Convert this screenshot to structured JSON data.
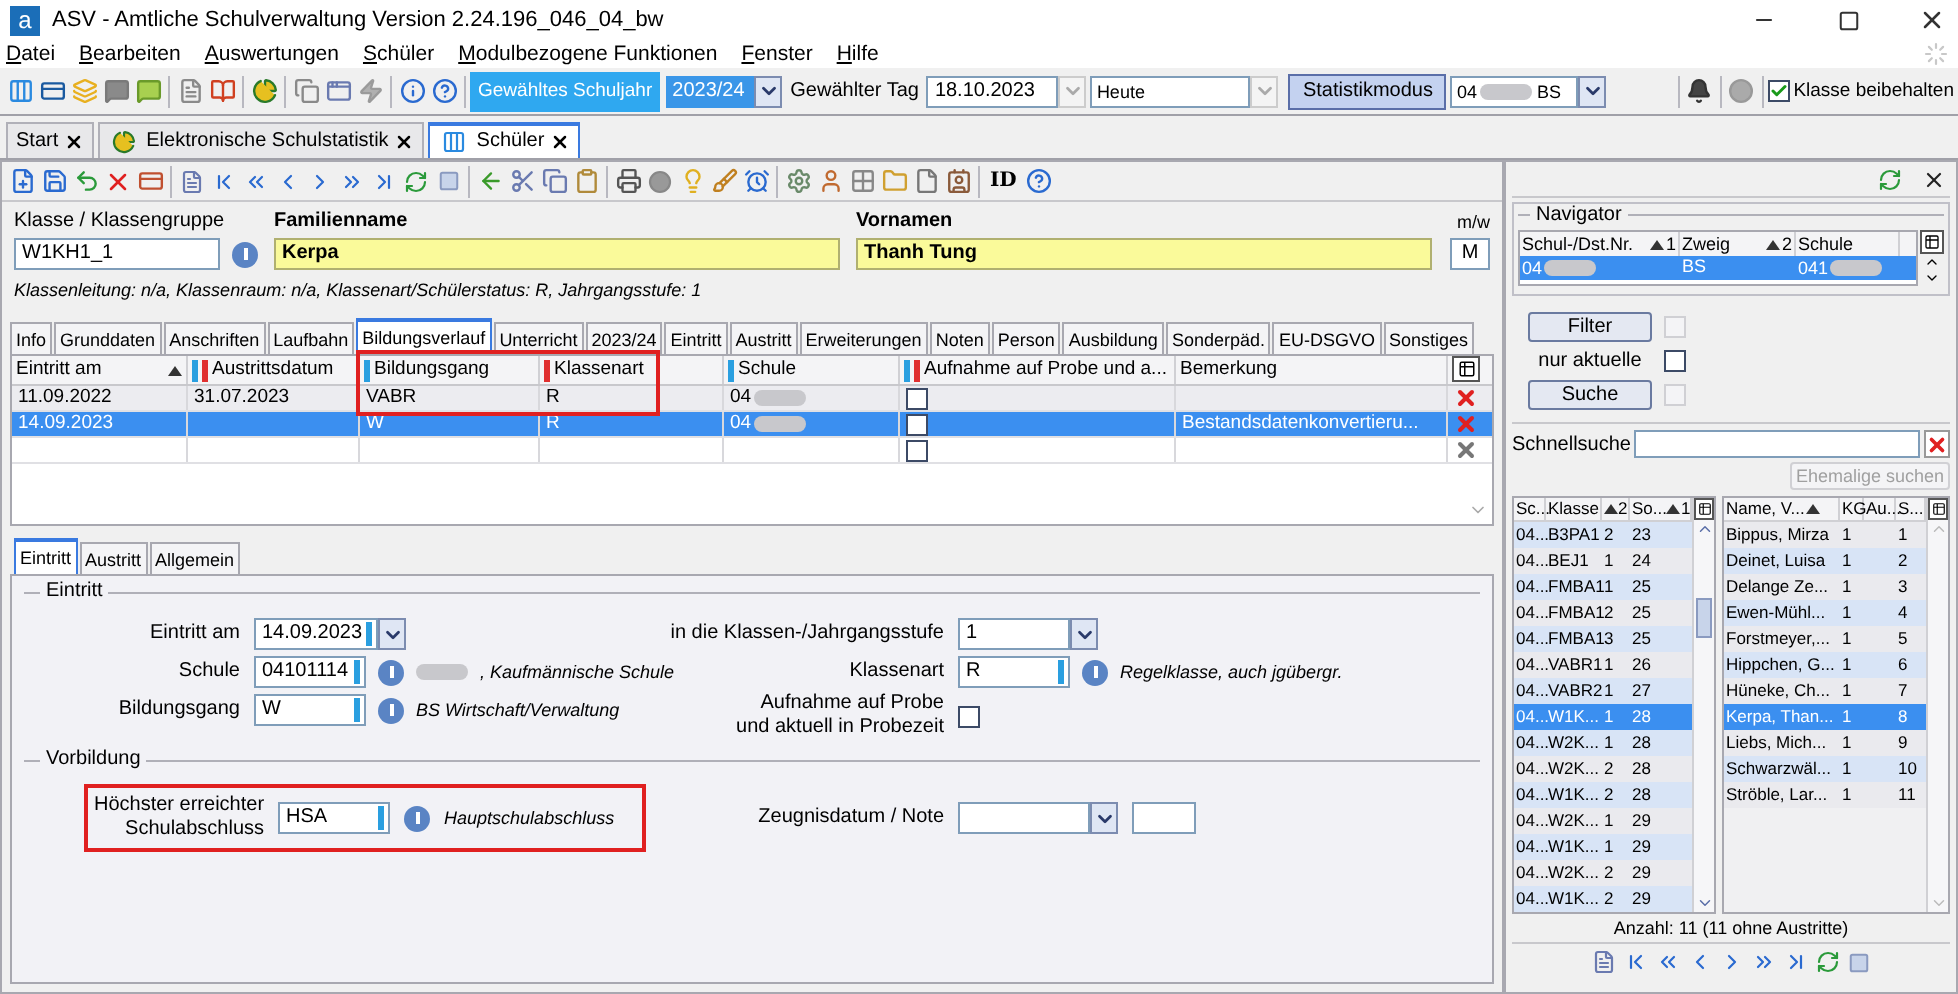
{
  "window": {
    "logo": "a",
    "title": "ASV - Amtliche Schulverwaltung Version 2.24.196_046_04_bw"
  },
  "menu": [
    "Datei",
    "Bearbeiten",
    "Auswertungen",
    "Schüler",
    "Modulbezogene Funktionen",
    "Fenster",
    "Hilfe"
  ],
  "toolbar": {
    "year_button": "Gewähltes Schuljahr",
    "year": "2023/24",
    "day_label": "Gewählter Tag",
    "day": "18.10.2023",
    "day_mode": "Heute",
    "stats_button": "Statistikmodus",
    "school": "04",
    "school_branch": "BS",
    "keep_class": {
      "label": "Klasse beibehalten",
      "checked": true
    }
  },
  "doc_tabs": [
    {
      "label": "Start",
      "selected": false,
      "kind": "plain"
    },
    {
      "label": "Elektronische Schulstatistik",
      "selected": false,
      "kind": "statistics"
    },
    {
      "label": "Schüler",
      "selected": true,
      "kind": "students"
    }
  ],
  "module_toolbar": {
    "id_label": "ID"
  },
  "student": {
    "class_label": "Klasse / Klassengruppe",
    "class": "W1KH1_1",
    "surname_label": "Familienname",
    "surname": "Kerpa",
    "firstname_label": "Vornamen",
    "firstname": "Thanh Tung",
    "gender_label": "m/w",
    "gender": "M",
    "info": "Klassenleitung: n/a, Klassenraum: n/a, Klassenart/Schülerstatus: R, Jahrgangsstufe: 1"
  },
  "tabs": [
    {
      "label": "Info",
      "selected": false
    },
    {
      "label": "Grunddaten",
      "selected": false
    },
    {
      "label": "Anschriften",
      "selected": false
    },
    {
      "label": "Laufbahn",
      "selected": false
    },
    {
      "label": "Bildungsverlauf",
      "selected": true
    },
    {
      "label": "Unterricht",
      "selected": false
    },
    {
      "label": "2023/24",
      "selected": false
    },
    {
      "label": "Eintritt",
      "selected": false
    },
    {
      "label": "Austritt",
      "selected": false
    },
    {
      "label": "Erweiterungen",
      "selected": false
    },
    {
      "label": "Noten",
      "selected": false
    },
    {
      "label": "Person",
      "selected": false
    },
    {
      "label": "Ausbildung",
      "selected": false
    },
    {
      "label": "Sonderpäd.",
      "selected": false
    },
    {
      "label": "EU-DSGVO",
      "selected": false
    },
    {
      "label": "Sonstiges",
      "selected": false
    }
  ],
  "history_table": {
    "columns": [
      {
        "label": "Eintritt am",
        "sorted": true,
        "linked": false,
        "mandatory": false
      },
      {
        "label": "Austrittsdatum",
        "sorted": false,
        "linked": true,
        "mandatory": true
      },
      {
        "label": "Bildungsgang",
        "sorted": false,
        "linked": true,
        "mandatory": false
      },
      {
        "label": "Klassenart",
        "sorted": false,
        "linked": false,
        "mandatory": true
      },
      {
        "label": "Schule",
        "sorted": false,
        "linked": true,
        "mandatory": false
      },
      {
        "label": "Aufnahme auf Probe und a...",
        "sorted": false,
        "linked": true,
        "mandatory": true
      },
      {
        "label": "Bemerkung",
        "sorted": false,
        "linked": false,
        "mandatory": false
      }
    ],
    "rows": [
      {
        "selected": false,
        "deletable": true,
        "probe": false,
        "entry": "11.09.2022",
        "exit": "31.07.2023",
        "course": "VABR",
        "class_type": "R",
        "school": "04"
      },
      {
        "selected": true,
        "deletable": true,
        "probe": false,
        "entry": "14.09.2023",
        "course": "W",
        "class_type": "R",
        "school": "04",
        "remark": "Bestandsdatenkonvertieru..."
      },
      {
        "selected": false,
        "deletable": false,
        "probe": false
      }
    ]
  },
  "detail": {
    "tabs": [
      {
        "label": "Eintritt",
        "selected": true
      },
      {
        "label": "Austritt",
        "selected": false
      },
      {
        "label": "Allgemein",
        "selected": false
      }
    ],
    "entry_title": "Eintritt",
    "left_fields": [
      {
        "kind": "combo",
        "label": "Eintritt am",
        "value": "14.09.2023",
        "marked": true
      },
      {
        "kind": "coded",
        "label": "Schule",
        "value": "04101114",
        "desc": ", Kaufmännische Schule",
        "redacted": true,
        "marked": true
      },
      {
        "kind": "coded",
        "label": "Bildungsgang",
        "value": "W",
        "desc": "BS Wirtschaft/Verwaltung",
        "marked": true
      }
    ],
    "right_fields": [
      {
        "kind": "combo",
        "label": "in die Klassen-/Jahrgangsstufe",
        "value": "1",
        "marked": false
      },
      {
        "kind": "coded",
        "label": "Klassenart",
        "value": "R",
        "desc": "Regelklasse, auch jgübergr.",
        "marked": true
      },
      {
        "kind": "check",
        "label_lines": [
          "Aufnahme auf Probe",
          "und aktuell in Probezeit"
        ],
        "checked": false
      }
    ],
    "prior_title": "Vorbildung",
    "prior_field": {
      "label_lines": [
        "Höchster erreichter",
        "Schulabschluss"
      ],
      "value": "HSA",
      "desc": "Hauptschulabschluss",
      "marked": true
    },
    "certificate_label": "Zeugnisdatum / Note"
  },
  "navigator": {
    "title": "Navigator",
    "columns": [
      {
        "label": "Schul-/Dst.Nr.",
        "sort_rank": "1"
      },
      {
        "label": "Zweig",
        "sort_rank": "2"
      },
      {
        "label": "Schule"
      }
    ],
    "row": {
      "number": "04",
      "branch": "BS",
      "school": "041",
      "selected": true
    },
    "filter": {
      "label": "Filter",
      "checked": false,
      "disabled": true
    },
    "only_current": {
      "label": "nur aktuelle",
      "checked": false
    },
    "search": {
      "label": "Suche",
      "checked": false,
      "disabled": true
    },
    "quick_search_label": "Schnellsuche",
    "former_button": {
      "label": "Ehemalige suchen",
      "disabled": true
    },
    "class_list": {
      "columns": [
        {
          "label": "Sc..."
        },
        {
          "label": "Klasse"
        },
        {
          "sort_rank": "2"
        },
        {
          "label": "So...",
          "sort_rank": "1"
        }
      ],
      "rows": [
        {
          "c": [
            "04...",
            "B3PA1",
            "2",
            "23"
          ],
          "selected": false
        },
        {
          "c": [
            "04...",
            "BEJ1",
            "1",
            "24"
          ],
          "selected": false
        },
        {
          "c": [
            "04...",
            "FMBA1",
            "1",
            "25"
          ],
          "selected": false
        },
        {
          "c": [
            "04...",
            "FMBA1",
            "2",
            "25"
          ],
          "selected": false
        },
        {
          "c": [
            "04...",
            "FMBA1",
            "3",
            "25"
          ],
          "selected": false
        },
        {
          "c": [
            "04...",
            "VABR1",
            "1",
            "26"
          ],
          "selected": false
        },
        {
          "c": [
            "04...",
            "VABR2",
            "1",
            "27"
          ],
          "selected": false
        },
        {
          "c": [
            "04...",
            "W1K...",
            "1",
            "28"
          ],
          "selected": true
        },
        {
          "c": [
            "04...",
            "W2K...",
            "1",
            "28"
          ],
          "selected": false
        },
        {
          "c": [
            "04...",
            "W2K...",
            "2",
            "28"
          ],
          "selected": false
        },
        {
          "c": [
            "04...",
            "W1K...",
            "2",
            "28"
          ],
          "selected": false
        },
        {
          "c": [
            "04...",
            "W2K...",
            "1",
            "29"
          ],
          "selected": false
        },
        {
          "c": [
            "04...",
            "W1K...",
            "1",
            "29"
          ],
          "selected": false
        },
        {
          "c": [
            "04...",
            "W2K...",
            "2",
            "29"
          ],
          "selected": false
        },
        {
          "c": [
            "04...",
            "W1K...",
            "2",
            "29"
          ],
          "selected": false
        }
      ]
    },
    "student_list": {
      "columns": [
        {
          "label": "Name, V...",
          "sorted": true
        },
        {
          "label": "KG"
        },
        {
          "label": "Au..."
        },
        {
          "label": "S..."
        }
      ],
      "rows": [
        {
          "name": "Bippus, Mirza",
          "kg": "1",
          "s": "1",
          "selected": false
        },
        {
          "name": "Deinet, Luisa",
          "kg": "1",
          "s": "2",
          "selected": false
        },
        {
          "name": "Delange Ze...",
          "kg": "1",
          "s": "3",
          "selected": false
        },
        {
          "name": "Ewen-Mühl...",
          "kg": "1",
          "s": "4",
          "selected": false
        },
        {
          "name": "Forstmeyer,...",
          "kg": "1",
          "s": "5",
          "selected": false
        },
        {
          "name": "Hippchen, G...",
          "kg": "1",
          "s": "6",
          "selected": false
        },
        {
          "name": "Hüneke, Ch...",
          "kg": "1",
          "s": "7",
          "selected": false
        },
        {
          "name": "Kerpa, Than...",
          "kg": "1",
          "s": "8",
          "selected": true
        },
        {
          "name": "Liebs, Mich...",
          "kg": "1",
          "s": "9",
          "selected": false
        },
        {
          "name": "Schwarzwäl...",
          "kg": "1",
          "s": "10",
          "selected": false
        },
        {
          "name": "Ströble, Lar...",
          "kg": "1",
          "s": "11",
          "selected": false
        }
      ]
    },
    "count": "Anzahl: 11 (11 ohne Austritte)"
  }
}
